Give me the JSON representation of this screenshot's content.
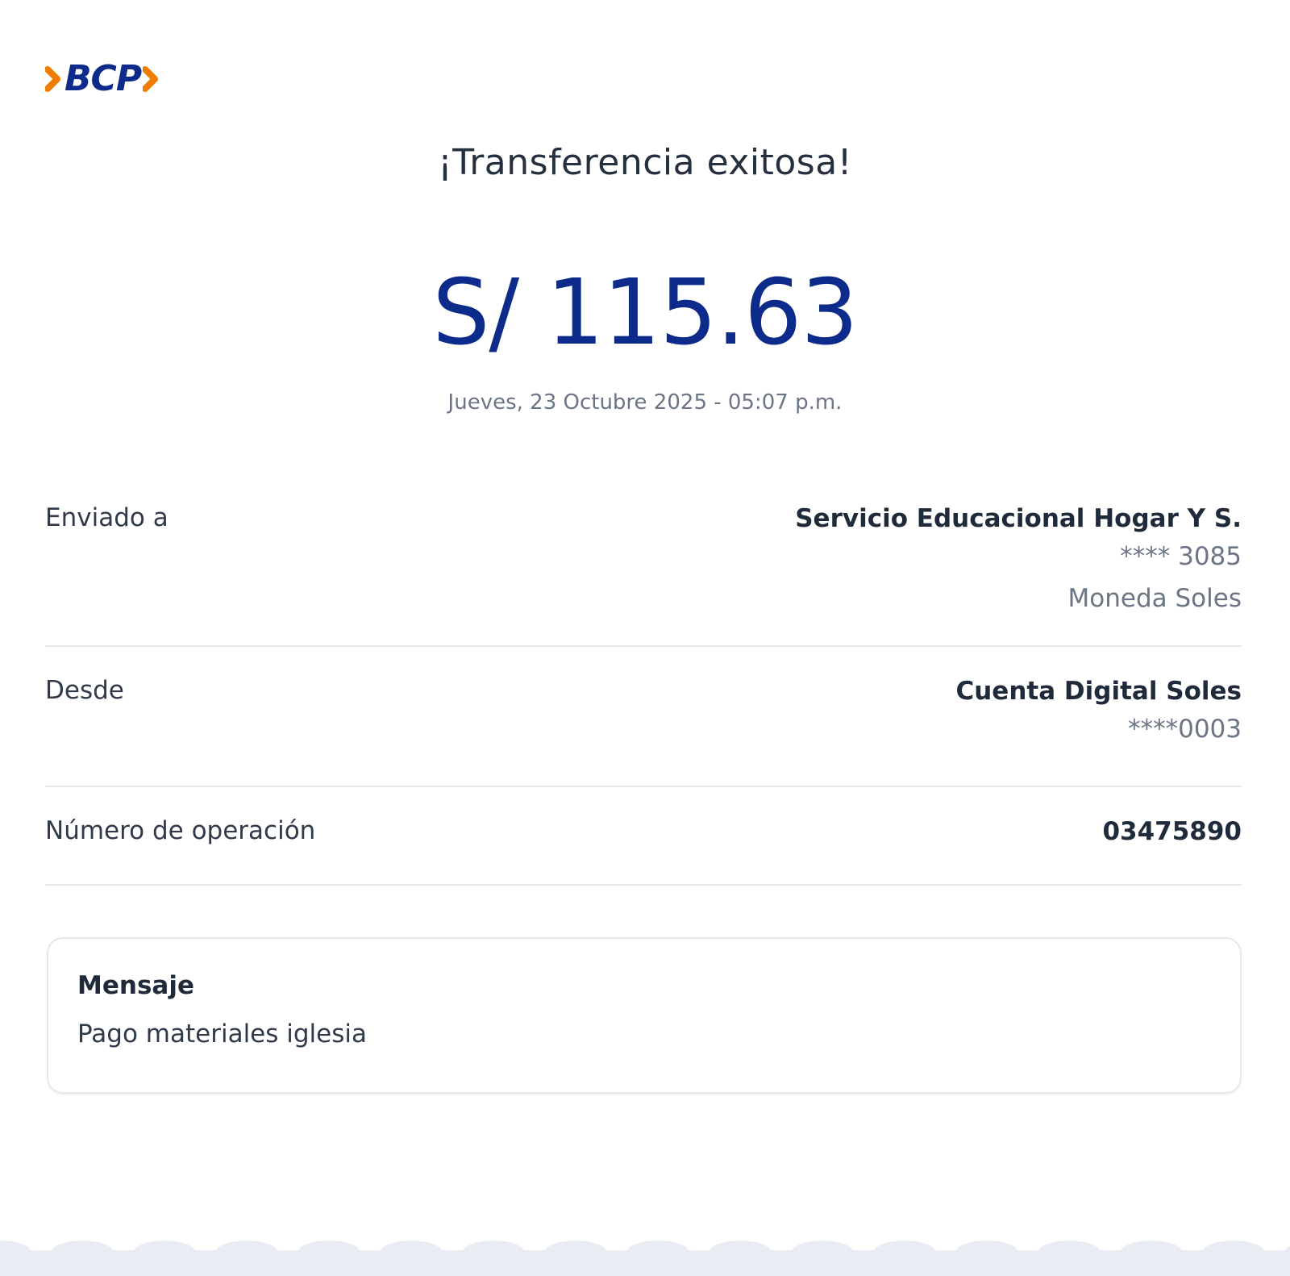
{
  "brand": {
    "logo_text": "BCP",
    "primary_color": "#0c2b8a",
    "accent_color": "#f07d00"
  },
  "title": "¡Transferencia exitosa!",
  "amount": "S/ 115.63",
  "datetime": "Jueves, 23 Octubre 2025 - 05:07 p.m.",
  "details": {
    "enviado": {
      "label": "Enviado a",
      "name": "Servicio Educacional Hogar Y S.",
      "account": "**** 3085",
      "currency": "Moneda Soles"
    },
    "desde": {
      "label": "Desde",
      "name": "Cuenta Digital Soles",
      "account": "****0003"
    },
    "operacion": {
      "label": "Número de operación",
      "value": "03475890"
    }
  },
  "message": {
    "label": "Mensaje",
    "text": "Pago materiales iglesia"
  }
}
